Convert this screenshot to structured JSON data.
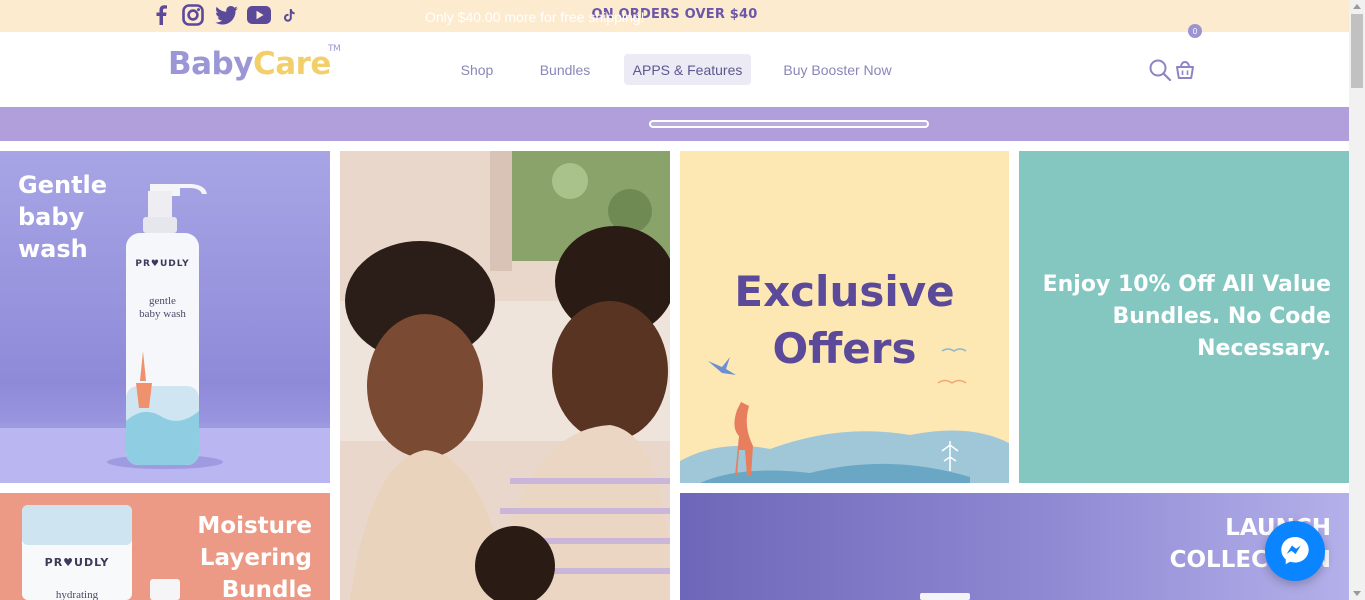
{
  "topbar": {
    "promo": "ON ORDERS OVER $40",
    "social": [
      "facebook-icon",
      "instagram-icon",
      "twitter-icon",
      "youtube-icon",
      "tiktok-icon"
    ]
  },
  "header": {
    "logo_baby": "Baby",
    "logo_care": "Care",
    "logo_tm": "TM",
    "nav": [
      {
        "label": "Shop"
      },
      {
        "label": "Bundles"
      },
      {
        "label": "APPS & Features",
        "active": true
      },
      {
        "label": "Buy Booster Now"
      }
    ],
    "icons": [
      "search-icon",
      "cart-icon"
    ],
    "cart_count": "0"
  },
  "shipping": {
    "text": "Only $40.00 more for free shipping!",
    "progress": 0
  },
  "tiles": {
    "gentle": {
      "title": [
        "Gentle",
        "baby",
        "wash"
      ],
      "bottle_brand": "PR♥UDLY",
      "bottle_label": [
        "gentle",
        "baby wash"
      ]
    },
    "exclusive": {
      "title": [
        "Exclusive",
        "Offers"
      ]
    },
    "value": {
      "title": [
        "Enjoy 10% Off All Value",
        "Bundles. No Code",
        "Necessary."
      ]
    },
    "moisture": {
      "title": [
        "Moisture",
        "Layering",
        "Bundle"
      ],
      "tube_brand": "PR♥UDLY",
      "tube_label": "hydrating"
    },
    "launch": {
      "title": [
        "LAUNCH",
        "COLLECTION"
      ]
    }
  },
  "colors": {
    "topbar": "#fdebd0",
    "shipbar": "#b09fdb",
    "brand_purple": "#6b56a8",
    "logo_care": "#f2cf6b",
    "exclusive_bg": "#fde8b4",
    "value_bg": "#84c6c0",
    "messenger": "#0a84ff"
  },
  "widgets": {
    "chat": "messenger-icon"
  }
}
